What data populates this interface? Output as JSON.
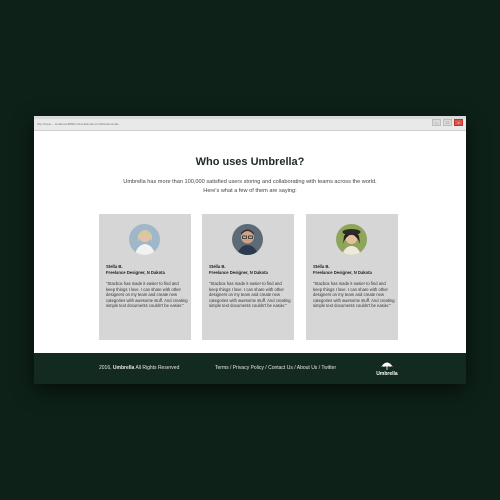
{
  "browser": {
    "status_text": "http://www.... localhost:8080/umbrella/index.html#testimonials"
  },
  "section": {
    "title": "Who uses Umbrella?",
    "subtitle": "Umbrella has more than 100,000 satisfied users storing and collaborating with teams across the world. Here's what a few of them are saying:"
  },
  "testimonials": [
    {
      "name": "Stella B.",
      "role": "Freelance Designer, N Dakota",
      "quote": "\"Stacbox has made it easier to find and keep things I love. I can share with other designers on my team and create new categories with awesome stuff. And creating simple text documents couldn't be easier.\""
    },
    {
      "name": "Stella B.",
      "role": "Freelance Designer, N Dakota",
      "quote": "\"Stacbox has made it easier to find and keep things I love. I can share with other designers on my team and create new categories with awesome stuff. And creating simple text documents couldn't be easier.\""
    },
    {
      "name": "Stella B.",
      "role": "Freelance Designer, N Dakota",
      "quote": "\"Stacbox has made it easier to find and keep things I love. I can share with other designers on my team and create new categories with awesome stuff. And creating simple text documents couldn't be easier.\""
    }
  ],
  "footer": {
    "year": "2016,",
    "brand": "Umbrella",
    "rights": "All Rights Reserved",
    "links": [
      "Terms",
      "Privacy Policy",
      "Contact Us",
      "About Us",
      "Twitter"
    ],
    "logo_text": "Umbrella"
  },
  "colors": {
    "page_background": "#0d2118",
    "footer_background": "#122a1f",
    "card_background": "#d6d6d6"
  }
}
